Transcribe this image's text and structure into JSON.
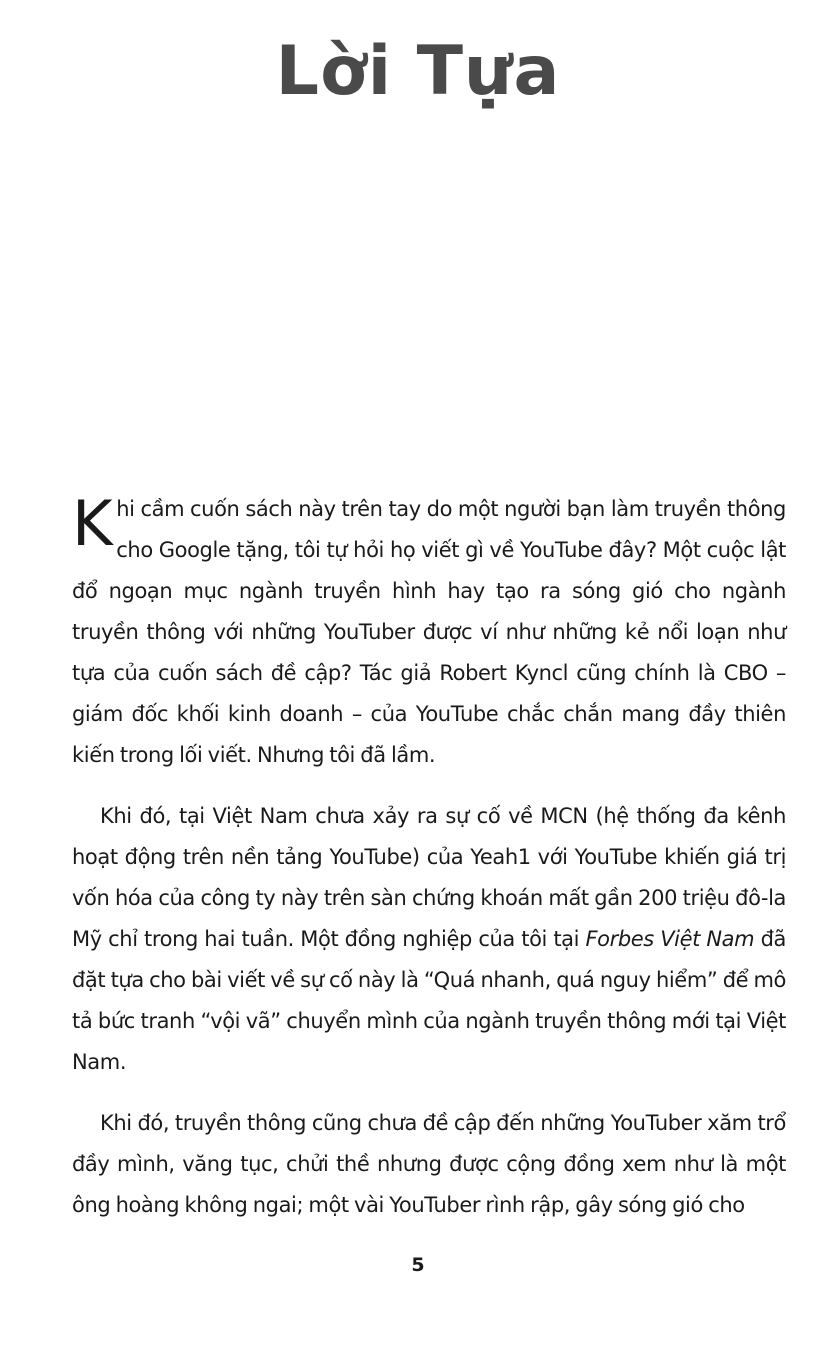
{
  "title": "Lời Tựa",
  "paragraphs": [
    {
      "dropcap": "K",
      "text": "hi cầm cuốn sách này trên tay do một người bạn làm truyền thông cho Google tặng, tôi tự hỏi họ viết gì về YouTube đây? Một cuộc lật đổ ngoạn mục ngành truyền hình hay tạo ra sóng gió cho ngành truyền thông với những YouTuber được ví như những kẻ nổi loạn như tựa của cuốn sách đề cập? Tác giả Robert Kyncl cũng chính là CBO – giám đốc khối kinh doanh – của YouTube chắc chắn mang đầy thiên kiến trong lối viết. Nhưng tôi đã lầm."
    },
    {
      "text_before": "Khi đó, tại Việt Nam chưa xảy ra sự cố về MCN (hệ thống đa kênh hoạt động trên nền tảng YouTube) của Yeah1 với YouTube khiến giá trị vốn hóa của công ty này trên sàn chứng khoán mất gần 200 triệu đô-la Mỹ chỉ trong hai tuần. Một đồng nghiệp của tôi tại ",
      "italic": "Forbes Việt Nam",
      "text_after": " đã đặt tựa cho bài viết về sự cố này là “Quá nhanh, quá nguy hiểm” để mô tả bức tranh “vội vã” chuyển mình của ngành truyền thông mới tại Việt Nam."
    },
    {
      "text": "Khi đó, truyền thông cũng chưa đề cập đến những YouTuber xăm trổ đầy mình, văng tục, chửi thề nhưng được cộng đồng xem như là một ông hoàng không ngai; một vài YouTuber rình rập, gây sóng gió cho"
    }
  ],
  "page_number": "5"
}
